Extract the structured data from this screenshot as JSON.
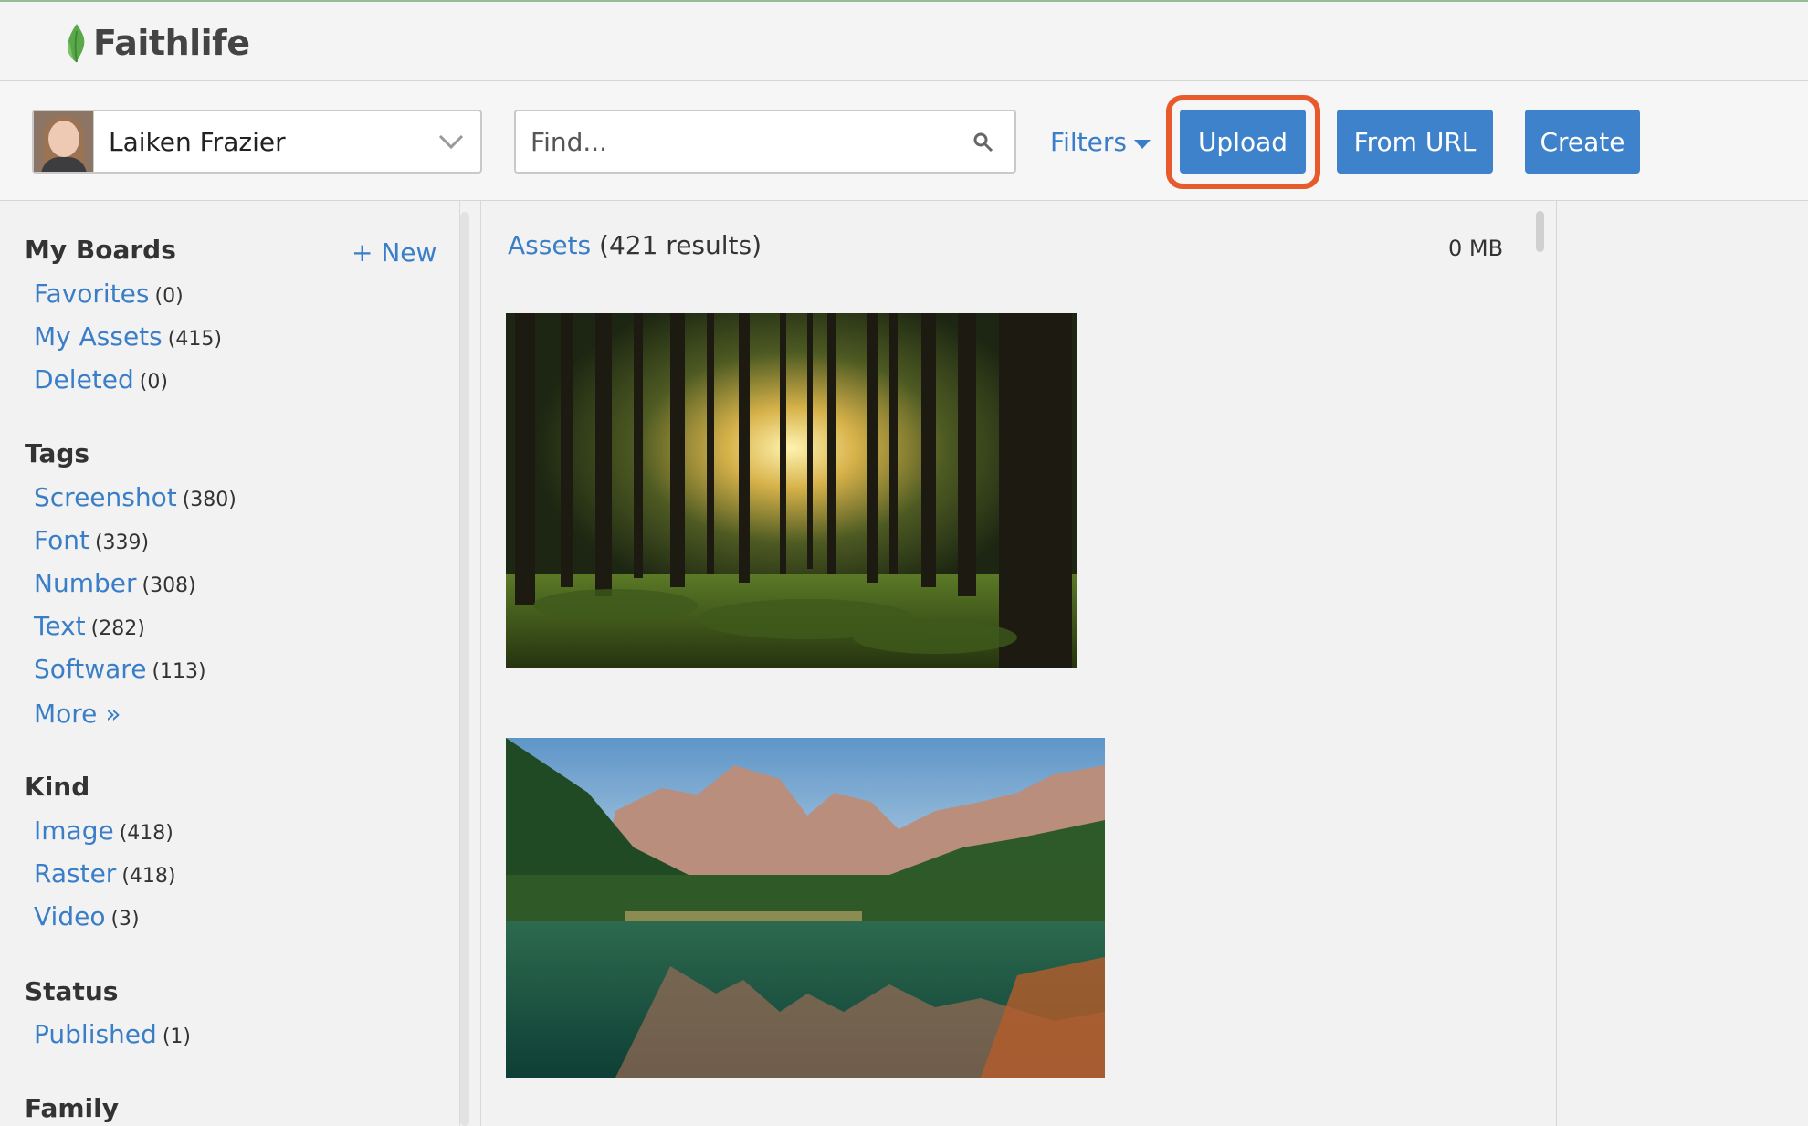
{
  "app": {
    "brand": "Faithlife"
  },
  "account": {
    "name": "Laiken Frazier"
  },
  "search": {
    "placeholder": "Find..."
  },
  "toolbar": {
    "filters_label": "Filters",
    "upload_label": "Upload",
    "from_url_label": "From URL",
    "create_label": "Create"
  },
  "sidebar": {
    "boards": {
      "title": "My Boards",
      "new_label": "+ New",
      "items": [
        {
          "label": "Favorites",
          "count": "(0)"
        },
        {
          "label": "My Assets",
          "count": "(415)"
        },
        {
          "label": "Deleted",
          "count": "(0)"
        }
      ]
    },
    "tags": {
      "title": "Tags",
      "items": [
        {
          "label": "Screenshot",
          "count": "(380)"
        },
        {
          "label": "Font",
          "count": "(339)"
        },
        {
          "label": "Number",
          "count": "(308)"
        },
        {
          "label": "Text",
          "count": "(282)"
        },
        {
          "label": "Software",
          "count": "(113)"
        }
      ],
      "more_label": "More »"
    },
    "kind": {
      "title": "Kind",
      "items": [
        {
          "label": "Image",
          "count": "(418)"
        },
        {
          "label": "Raster",
          "count": "(418)"
        },
        {
          "label": "Video",
          "count": "(3)"
        }
      ]
    },
    "status": {
      "title": "Status",
      "items": [
        {
          "label": "Published",
          "count": "(1)"
        }
      ]
    },
    "family": {
      "title": "Family"
    }
  },
  "main": {
    "assets_link": "Assets",
    "results": "(421 results)",
    "size": "0 MB"
  },
  "colors": {
    "accent": "#3e82cc",
    "link": "#3a7ec8",
    "highlight": "#e85a2c",
    "brand_leaf": "#5aa84a"
  }
}
